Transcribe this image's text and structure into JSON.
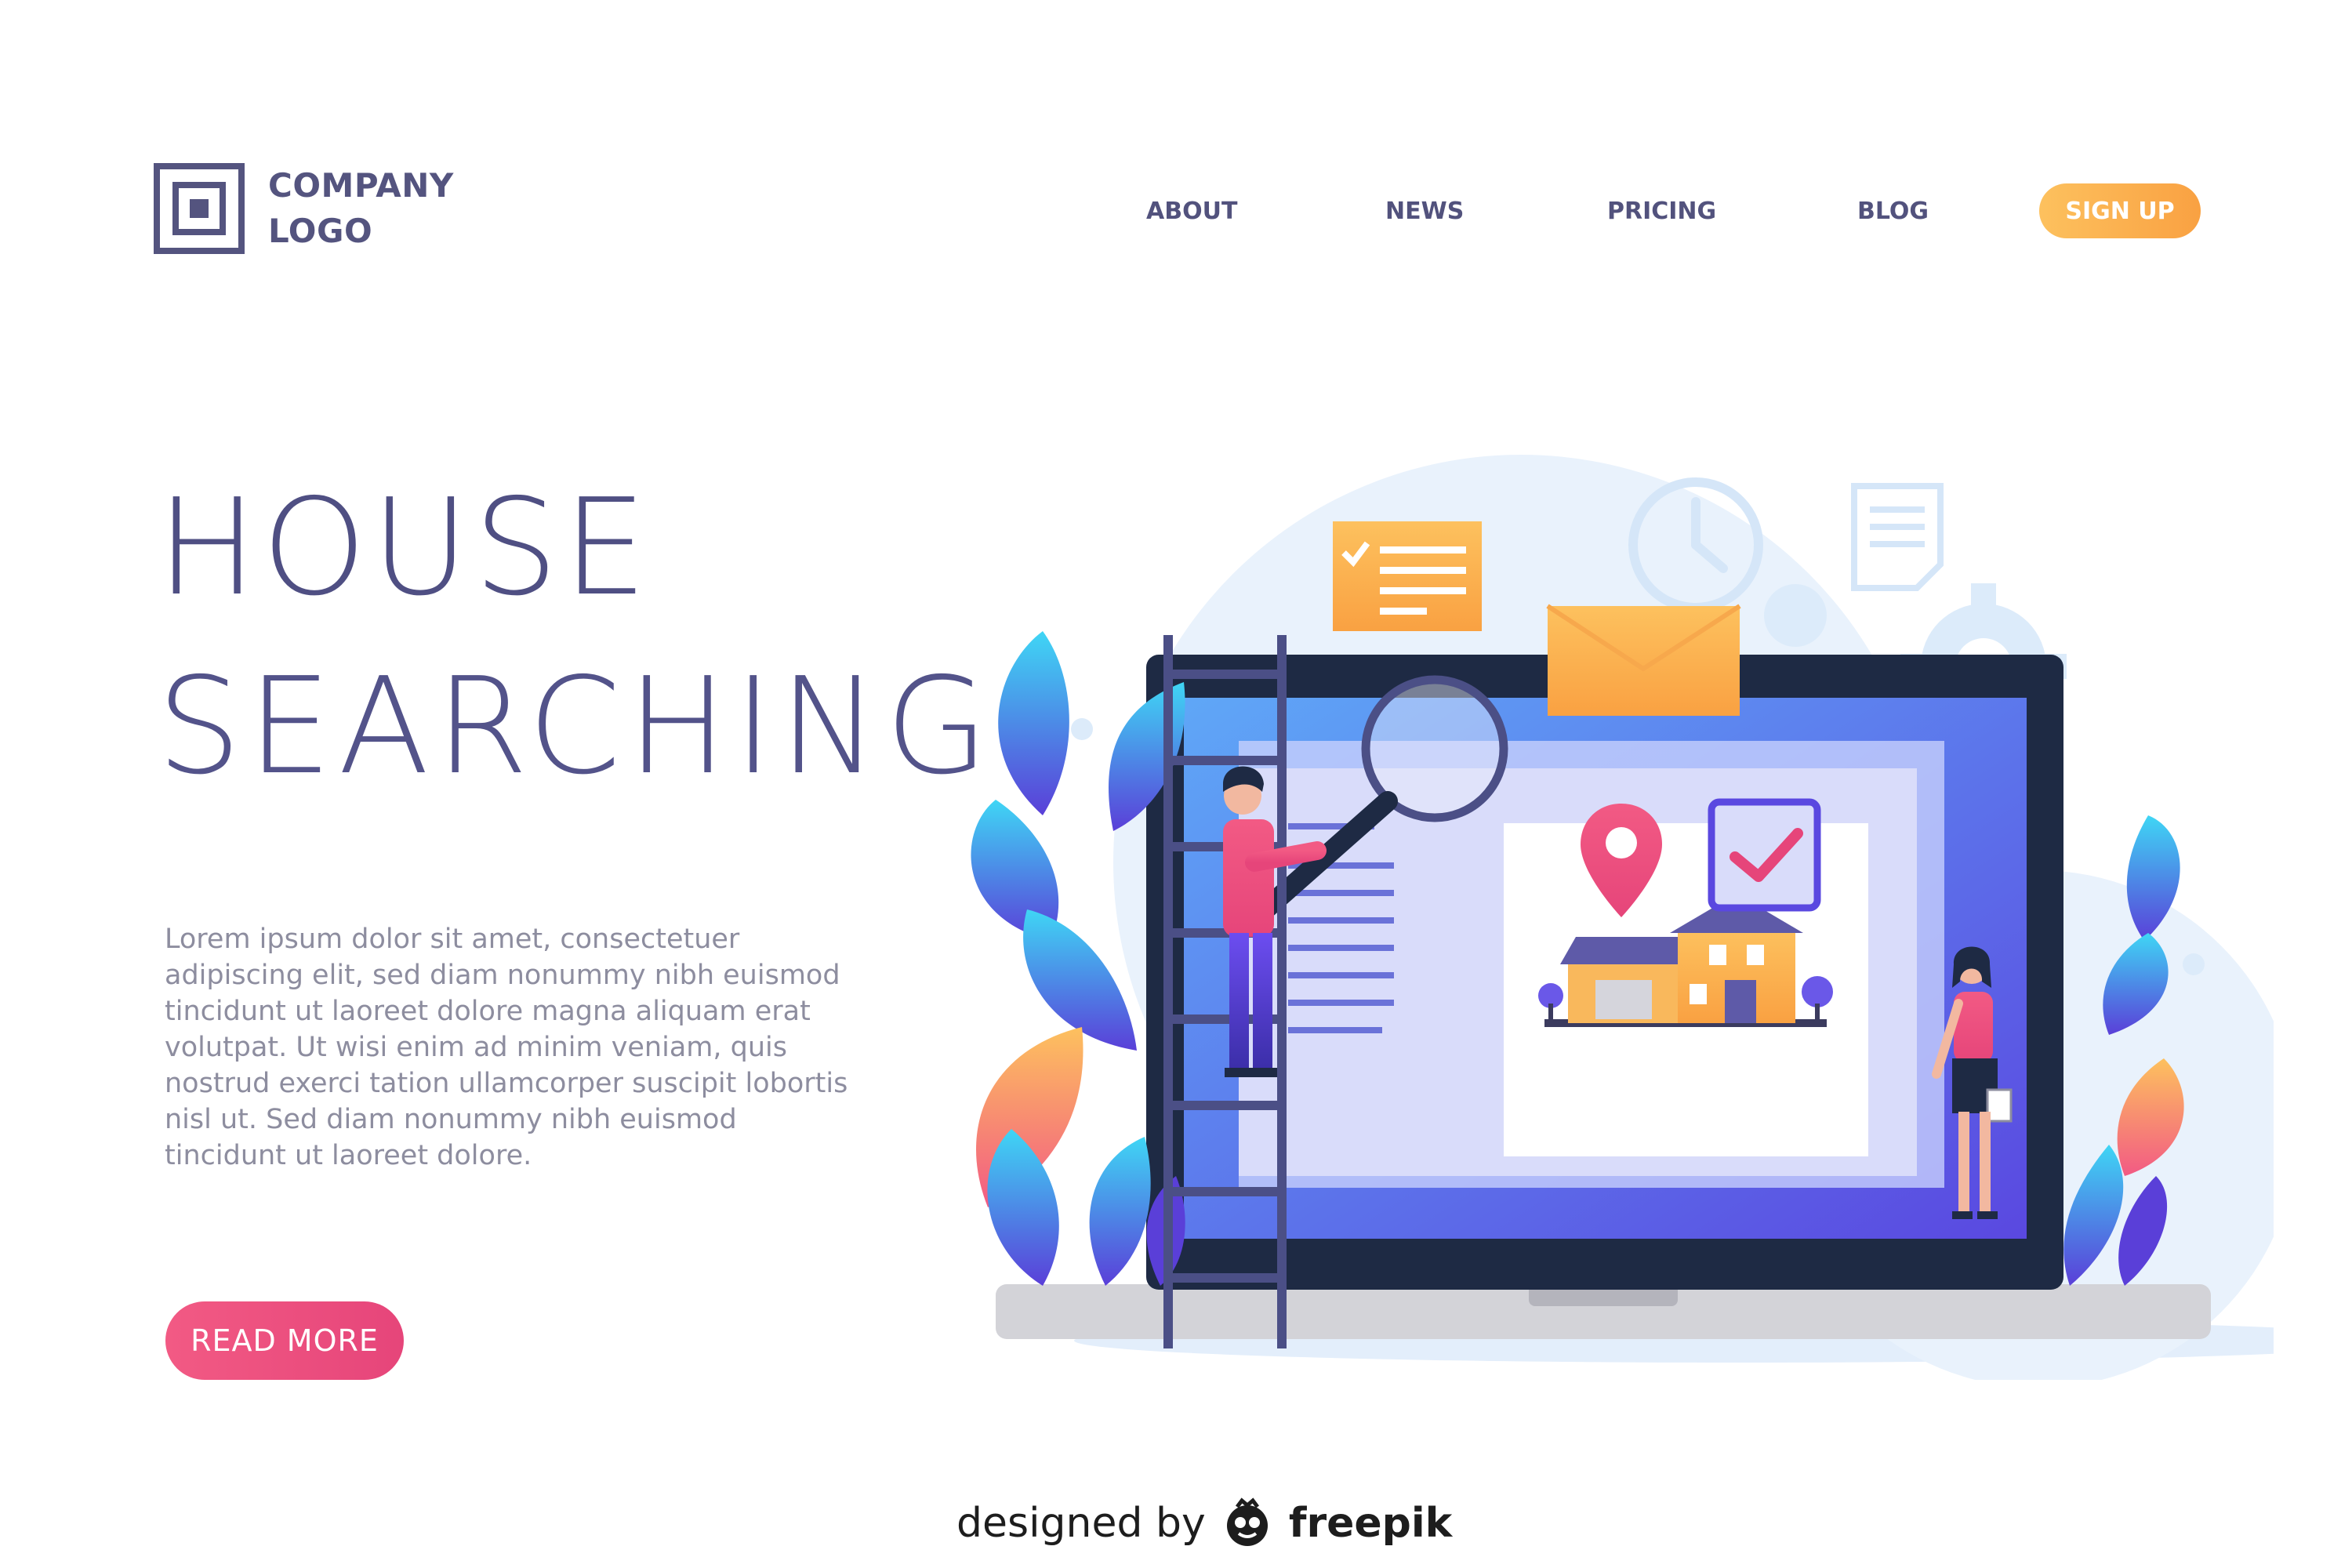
{
  "header": {
    "logo_line1": "COMPANY",
    "logo_line2": "LOGO",
    "nav": [
      "ABOUT",
      "NEWS",
      "PRICING",
      "BLOG"
    ],
    "signup_label": "SIGN UP"
  },
  "hero": {
    "title_line1": "HOUSE",
    "title_line2": "SEARCHING",
    "body": "Lorem ipsum dolor sit amet, consectetuer adipiscing elit, sed diam nonummy nibh euismod tincidunt ut laoreet dolore magna aliquam erat volutpat. Ut wisi enim ad minim veniam, quis nostrud exerci tation ullamcorper suscipit lobortis nisl ut. Sed diam nonummy nibh euismod tincidunt ut laoreet dolore.",
    "cta_label": "READ MORE"
  },
  "footer": {
    "credit_prefix": "designed by",
    "credit_brand": "freepik"
  },
  "illustration": {
    "icons": [
      "checklist-icon",
      "clock-icon",
      "document-icon",
      "gear-icon",
      "envelope-icon",
      "magnifier-icon",
      "location-pin-icon",
      "house-icon",
      "checkbox-icon",
      "ladder-icon",
      "laptop-icon",
      "leaf-icon",
      "man-figure",
      "woman-figure"
    ]
  },
  "colors": {
    "primary_text": "#4f4f83",
    "signup_gradient": [
      "#fdc15e",
      "#f9a142"
    ],
    "cta_gradient": [
      "#f25a84",
      "#e6457a"
    ],
    "laptop_frame": "#1e2a44",
    "screen_blue": "#5f7cf6"
  }
}
